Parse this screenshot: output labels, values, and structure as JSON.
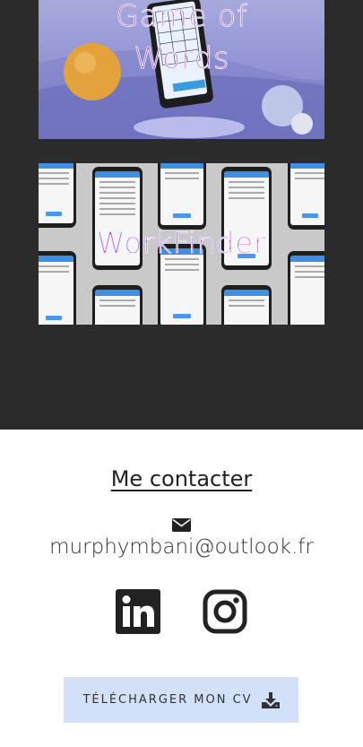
{
  "projects": [
    {
      "title": "Game of Words"
    },
    {
      "title": "WorkFinder"
    }
  ],
  "contact": {
    "heading": "Me contacter",
    "email": "murphymbani@outlook.fr"
  },
  "social": [
    {
      "name": "LinkedIn",
      "icon": "linkedin-icon"
    },
    {
      "name": "Instagram",
      "icon": "instagram-icon"
    }
  ],
  "cv_button": {
    "label": "TÉLÉCHARGER MON CV",
    "icon": "download-icon"
  },
  "colors": {
    "dark_bg": "#2b2b2b",
    "cv_button_bg": "#d3e1f8",
    "project_title": "#7a2fa3"
  }
}
